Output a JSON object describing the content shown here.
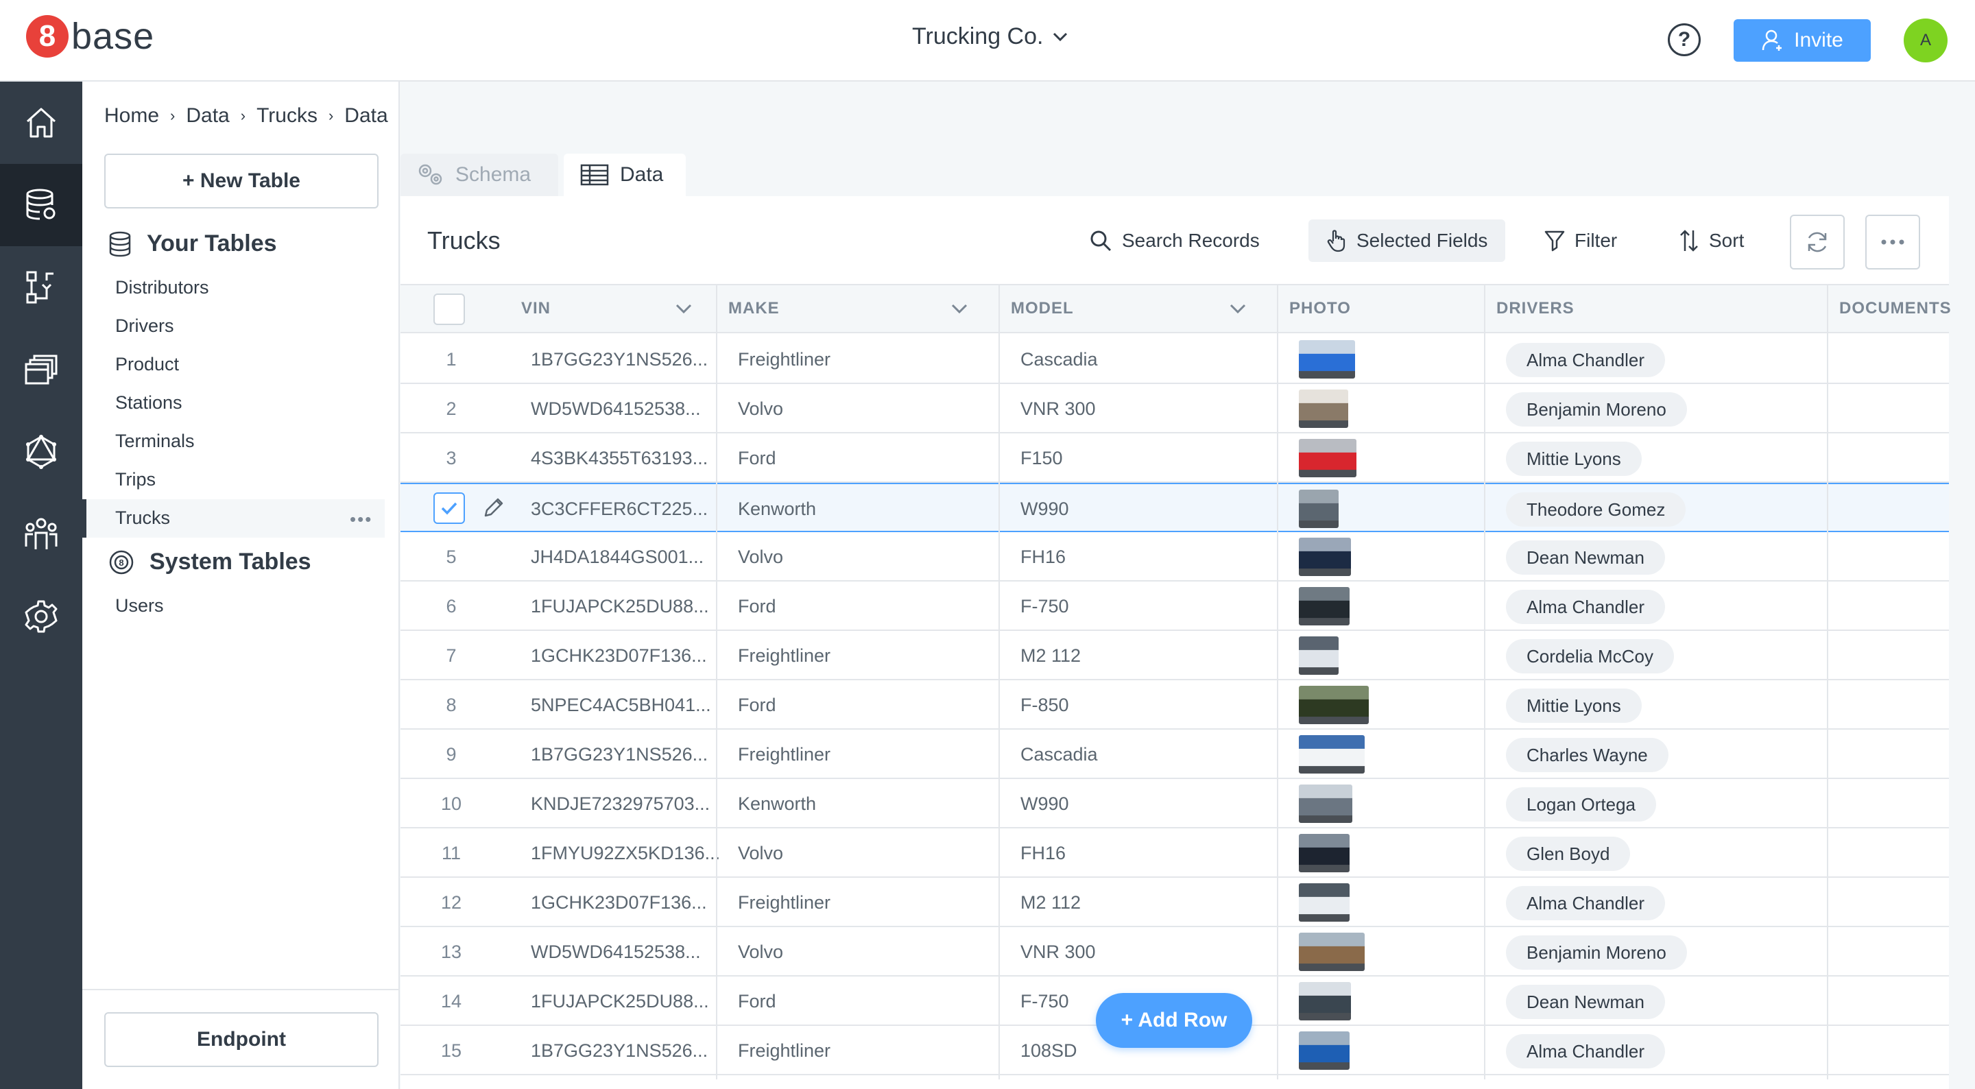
{
  "brand": {
    "badge": "8",
    "name": "base",
    "badge_color": "#e8413a"
  },
  "workspace": {
    "name": "Trucking Co."
  },
  "header": {
    "help_label": "?",
    "invite_label": "Invite",
    "avatar_initial": "A"
  },
  "rail": {
    "items": [
      "home-icon",
      "database-icon",
      "flow-icon",
      "pages-icon",
      "graphql-icon",
      "team-icon",
      "settings-icon"
    ],
    "active": "database-icon"
  },
  "breadcrumb": [
    "Home",
    "Data",
    "Trucks",
    "Data"
  ],
  "sidebar": {
    "new_table_label": "+ New Table",
    "your_tables_title": "Your Tables",
    "your_tables": [
      "Distributors",
      "Drivers",
      "Product",
      "Stations",
      "Terminals",
      "Trips",
      "Trucks"
    ],
    "active_table": "Trucks",
    "system_tables_title": "System Tables",
    "system_tables": [
      "Users"
    ],
    "endpoint_label": "Endpoint"
  },
  "tabs": {
    "schema": "Schema",
    "data": "Data",
    "active": "Data"
  },
  "panel": {
    "title": "Trucks",
    "search_label": "Search Records",
    "selected_fields_label": "Selected Fields",
    "filter_label": "Filter",
    "sort_label": "Sort"
  },
  "columns": [
    "VIN",
    "MAKE",
    "MODEL",
    "PHOTO",
    "DRIVERS",
    "DOCUMENTS"
  ],
  "rows": [
    {
      "n": "1",
      "vin": "1B7GG23Y1NS526...",
      "make": "Freightliner",
      "model": "Cascadia",
      "driver": "Alma Chandler"
    },
    {
      "n": "2",
      "vin": "WD5WD64152538...",
      "make": "Volvo",
      "model": "VNR 300",
      "driver": "Benjamin Moreno"
    },
    {
      "n": "3",
      "vin": "4S3BK4355T63193...",
      "make": "Ford",
      "model": "F150",
      "driver": "Mittie Lyons"
    },
    {
      "n": "4",
      "vin": "3C3CFFER6CT225...",
      "make": "Kenworth",
      "model": "W990",
      "driver": "Theodore Gomez",
      "selected": true
    },
    {
      "n": "5",
      "vin": "JH4DA1844GS001...",
      "make": "Volvo",
      "model": "FH16",
      "driver": "Dean Newman"
    },
    {
      "n": "6",
      "vin": "1FUJAPCK25DU88...",
      "make": "Ford",
      "model": "F-750",
      "driver": "Alma Chandler"
    },
    {
      "n": "7",
      "vin": "1GCHK23D07F136...",
      "make": "Freightliner",
      "model": "M2 112",
      "driver": "Cordelia McCoy"
    },
    {
      "n": "8",
      "vin": "5NPEC4AC5BH041...",
      "make": "Ford",
      "model": "F-850",
      "driver": "Mittie Lyons"
    },
    {
      "n": "9",
      "vin": "1B7GG23Y1NS526...",
      "make": "Freightliner",
      "model": "Cascadia",
      "driver": "Charles Wayne"
    },
    {
      "n": "10",
      "vin": "KNDJE7232975703...",
      "make": "Kenworth",
      "model": "W990",
      "driver": "Logan Ortega"
    },
    {
      "n": "11",
      "vin": "1FMYU92ZX5KD136...",
      "make": "Volvo",
      "model": "FH16",
      "driver": "Glen Boyd"
    },
    {
      "n": "12",
      "vin": "1GCHK23D07F136...",
      "make": "Freightliner",
      "model": "M2 112",
      "driver": "Alma Chandler"
    },
    {
      "n": "13",
      "vin": "WD5WD64152538...",
      "make": "Volvo",
      "model": "VNR 300",
      "driver": "Benjamin Moreno"
    },
    {
      "n": "14",
      "vin": "1FUJAPCK25DU88...",
      "make": "Ford",
      "model": "F-750",
      "driver": "Dean Newman"
    },
    {
      "n": "15",
      "vin": "1B7GG23Y1NS526...",
      "make": "Freightliner",
      "model": "108SD",
      "driver": "Alma Chandler"
    }
  ],
  "add_row_label": "+ Add Row",
  "colors": {
    "accent": "#4da1ff",
    "dark": "#323c47",
    "avatar": "#7ed321"
  }
}
